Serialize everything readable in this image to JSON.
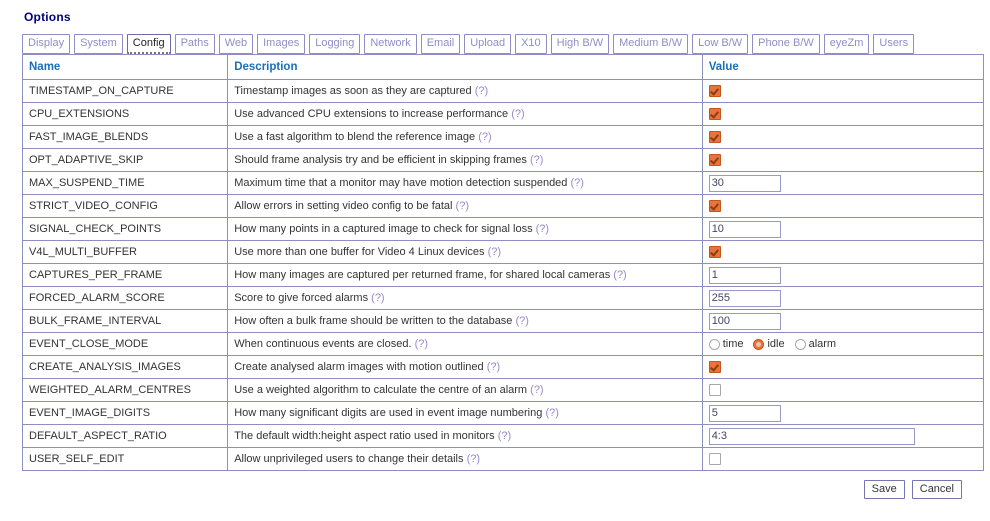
{
  "page": {
    "title": "Options"
  },
  "tabs": [
    {
      "label": "Display",
      "active": false
    },
    {
      "label": "System",
      "active": false
    },
    {
      "label": "Config",
      "active": true
    },
    {
      "label": "Paths",
      "active": false
    },
    {
      "label": "Web",
      "active": false
    },
    {
      "label": "Images",
      "active": false
    },
    {
      "label": "Logging",
      "active": false
    },
    {
      "label": "Network",
      "active": false
    },
    {
      "label": "Email",
      "active": false
    },
    {
      "label": "Upload",
      "active": false
    },
    {
      "label": "X10",
      "active": false
    },
    {
      "label": "High B/W",
      "active": false
    },
    {
      "label": "Medium B/W",
      "active": false
    },
    {
      "label": "Low B/W",
      "active": false
    },
    {
      "label": "Phone B/W",
      "active": false
    },
    {
      "label": "eyeZm",
      "active": false
    },
    {
      "label": "Users",
      "active": false
    }
  ],
  "table": {
    "headers": {
      "name": "Name",
      "description": "Description",
      "value": "Value"
    },
    "help_marker": "(?)",
    "rows": [
      {
        "name": "TIMESTAMP_ON_CAPTURE",
        "description": "Timestamp images as soon as they are captured",
        "control": "checkbox",
        "checked": true
      },
      {
        "name": "CPU_EXTENSIONS",
        "description": "Use advanced CPU extensions to increase performance",
        "control": "checkbox",
        "checked": true
      },
      {
        "name": "FAST_IMAGE_BLENDS",
        "description": "Use a fast algorithm to blend the reference image",
        "control": "checkbox",
        "checked": true
      },
      {
        "name": "OPT_ADAPTIVE_SKIP",
        "description": "Should frame analysis try and be efficient in skipping frames",
        "control": "checkbox",
        "checked": true
      },
      {
        "name": "MAX_SUSPEND_TIME",
        "description": "Maximum time that a monitor may have motion detection suspended",
        "control": "text",
        "value": "30",
        "width": "small"
      },
      {
        "name": "STRICT_VIDEO_CONFIG",
        "description": "Allow errors in setting video config to be fatal",
        "control": "checkbox",
        "checked": true
      },
      {
        "name": "SIGNAL_CHECK_POINTS",
        "description": "How many points in a captured image to check for signal loss",
        "control": "text",
        "value": "10",
        "width": "small"
      },
      {
        "name": "V4L_MULTI_BUFFER",
        "description": "Use more than one buffer for Video 4 Linux devices",
        "control": "checkbox",
        "checked": true
      },
      {
        "name": "CAPTURES_PER_FRAME",
        "description": "How many images are captured per returned frame, for shared local cameras",
        "control": "text",
        "value": "1",
        "width": "small"
      },
      {
        "name": "FORCED_ALARM_SCORE",
        "description": "Score to give forced alarms",
        "control": "text",
        "value": "255",
        "width": "small"
      },
      {
        "name": "BULK_FRAME_INTERVAL",
        "description": "How often a bulk frame should be written to the database",
        "control": "text",
        "value": "100",
        "width": "small"
      },
      {
        "name": "EVENT_CLOSE_MODE",
        "description": "When continuous events are closed.",
        "control": "radio",
        "options": [
          {
            "label": "time",
            "selected": false
          },
          {
            "label": "idle",
            "selected": true
          },
          {
            "label": "alarm",
            "selected": false
          }
        ]
      },
      {
        "name": "CREATE_ANALYSIS_IMAGES",
        "description": "Create analysed alarm images with motion outlined",
        "control": "checkbox",
        "checked": true
      },
      {
        "name": "WEIGHTED_ALARM_CENTRES",
        "description": "Use a weighted algorithm to calculate the centre of an alarm",
        "control": "checkbox",
        "checked": false
      },
      {
        "name": "EVENT_IMAGE_DIGITS",
        "description": "How many significant digits are used in event image numbering",
        "control": "text",
        "value": "5",
        "width": "small"
      },
      {
        "name": "DEFAULT_ASPECT_RATIO",
        "description": "The default width:height aspect ratio used in monitors",
        "control": "text",
        "value": "4:3",
        "width": "wide"
      },
      {
        "name": "USER_SELF_EDIT",
        "description": "Allow unprivileged users to change their details",
        "control": "checkbox",
        "checked": false
      }
    ]
  },
  "footer": {
    "save_label": "Save",
    "cancel_label": "Cancel"
  },
  "colors": {
    "accent_orange": "#e8743b",
    "border_lavender": "#8e8ec4",
    "header_blue": "#1a6fb5",
    "title_navy": "#000080",
    "help_purple": "#9b88c9"
  }
}
